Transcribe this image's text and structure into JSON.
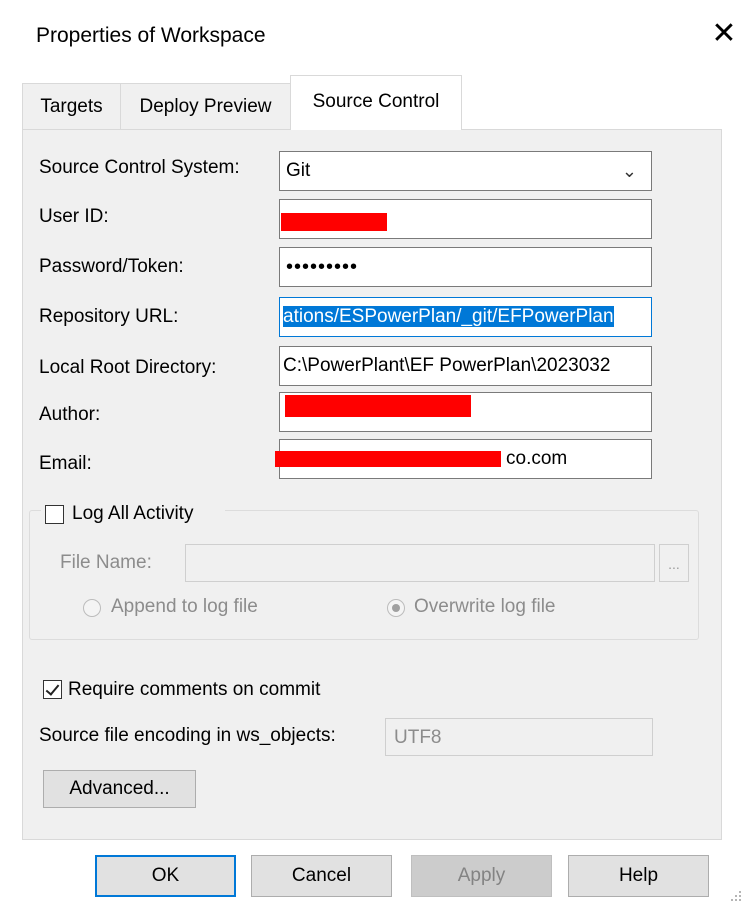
{
  "window": {
    "title": "Properties of Workspace",
    "close_glyph": "✕"
  },
  "tabs": [
    {
      "label": "Targets",
      "active": false
    },
    {
      "label": "Deploy Preview",
      "active": false
    },
    {
      "label": "Source Control",
      "active": true
    }
  ],
  "form": {
    "source_control_system": {
      "label": "Source Control System:",
      "value": "Git"
    },
    "user_id": {
      "label": "User ID:",
      "value": ""
    },
    "password": {
      "label": "Password/Token:",
      "value": "•••••••••"
    },
    "repository_url": {
      "label": "Repository URL:",
      "value": "ations/ESPowerPlan/_git/EFPowerPlan"
    },
    "local_root": {
      "label": "Local Root Directory:",
      "value": "C:\\PowerPlant\\EF PowerPlan\\2023032"
    },
    "author": {
      "label": "Author:",
      "value": ""
    },
    "email": {
      "label": "Email:",
      "value": "co.com"
    }
  },
  "log_group": {
    "checkbox_label": "Log All Activity",
    "checked": false,
    "file_name_label": "File Name:",
    "file_name_value": "",
    "browse_label": "...",
    "append_label": "Append to log file",
    "overwrite_label": "Overwrite log file",
    "selected_mode": "overwrite"
  },
  "require_comments": {
    "label": "Require comments on commit",
    "checked": true
  },
  "encoding": {
    "label": "Source file encoding in ws_objects:",
    "value": "UTF8"
  },
  "advanced_button": "Advanced...",
  "footer": {
    "ok": "OK",
    "cancel": "Cancel",
    "apply": "Apply",
    "help": "Help"
  },
  "colors": {
    "accent": "#0078d7",
    "redaction": "#ff0000",
    "panel_bg": "#f0f0f0"
  }
}
